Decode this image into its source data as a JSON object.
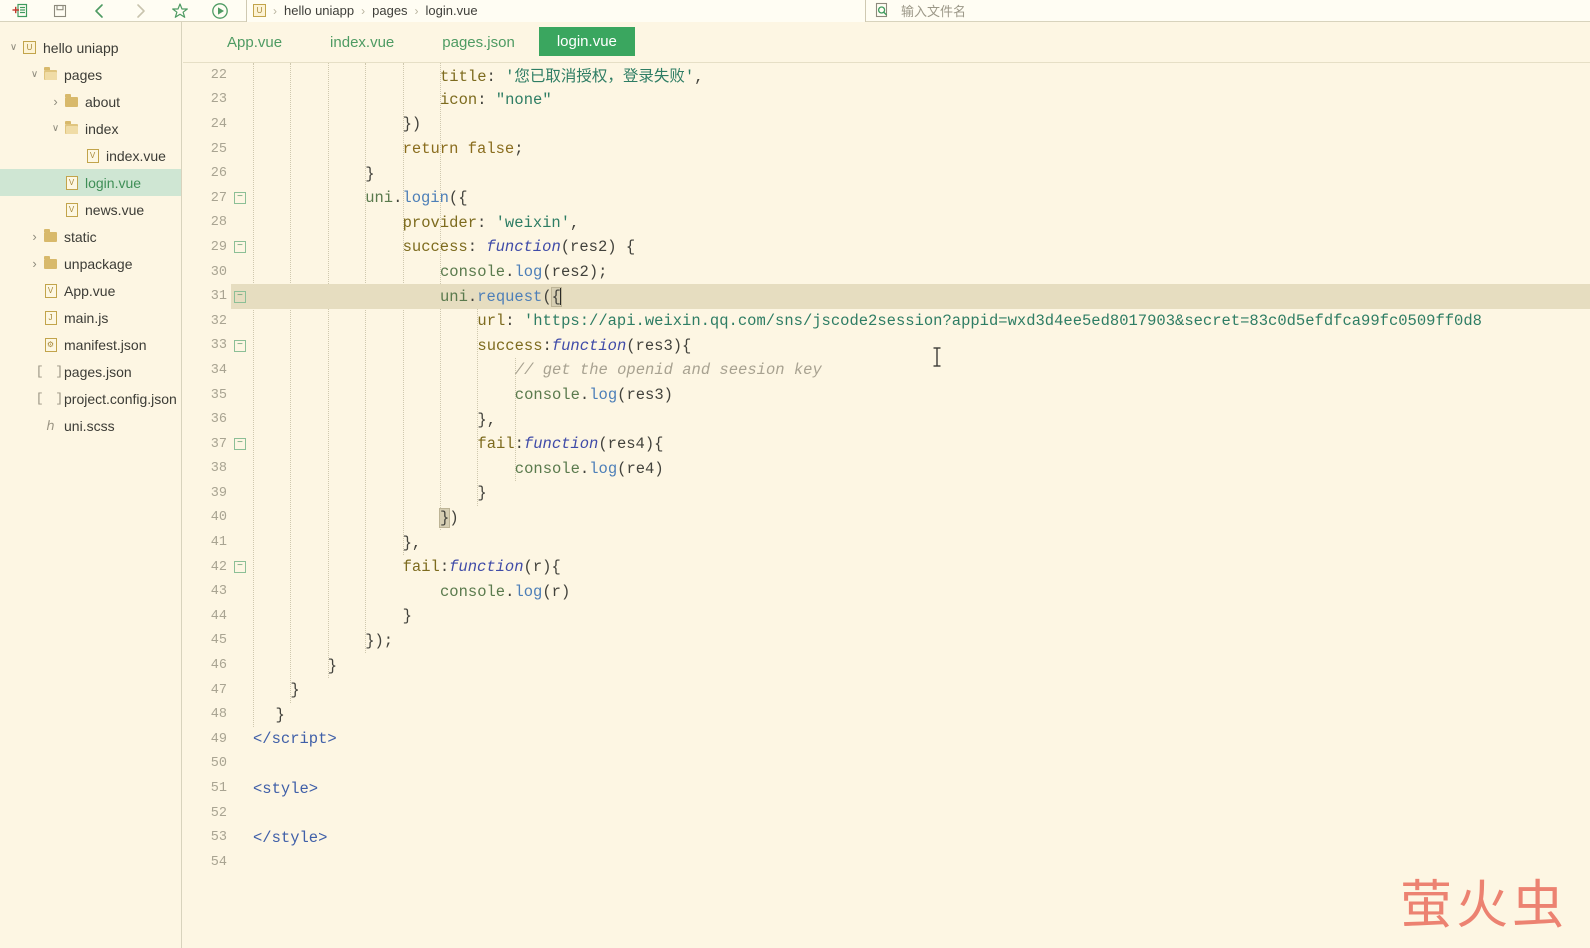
{
  "toolbar": {
    "buttons": [
      {
        "name": "new-file-icon",
        "label": "新建"
      },
      {
        "name": "save-icon",
        "label": "保存"
      },
      {
        "name": "back-arrow-icon",
        "label": "后退"
      },
      {
        "name": "forward-arrow-icon",
        "label": "前进"
      },
      {
        "name": "star-icon",
        "label": "收藏"
      },
      {
        "name": "run-icon",
        "label": "运行"
      }
    ]
  },
  "breadcrumb": {
    "project_icon": "U",
    "items": [
      "hello uniapp",
      "pages",
      "login.vue"
    ],
    "separator": "›"
  },
  "file_search": {
    "icon": "file-search-icon",
    "placeholder": "输入文件名",
    "value": ""
  },
  "sidebar": {
    "items": [
      {
        "label": "hello uniapp",
        "depth": 0,
        "type": "project",
        "expand": "down",
        "selected": false
      },
      {
        "label": "pages",
        "depth": 1,
        "type": "folder-open",
        "expand": "down",
        "selected": false
      },
      {
        "label": "about",
        "depth": 2,
        "type": "folder",
        "expand": "right",
        "selected": false
      },
      {
        "label": "index",
        "depth": 2,
        "type": "folder-open",
        "expand": "down",
        "selected": false
      },
      {
        "label": "index.vue",
        "depth": 3,
        "type": "vue",
        "expand": "none",
        "selected": false
      },
      {
        "label": "login.vue",
        "depth": 2,
        "type": "vue",
        "expand": "none",
        "selected": true
      },
      {
        "label": "news.vue",
        "depth": 2,
        "type": "vue",
        "expand": "none",
        "selected": false
      },
      {
        "label": "static",
        "depth": 1,
        "type": "folder",
        "expand": "right",
        "selected": false
      },
      {
        "label": "unpackage",
        "depth": 1,
        "type": "folder",
        "expand": "right",
        "selected": false
      },
      {
        "label": "App.vue",
        "depth": 1,
        "type": "vue",
        "expand": "none",
        "selected": false
      },
      {
        "label": "main.js",
        "depth": 1,
        "type": "js",
        "expand": "none",
        "selected": false
      },
      {
        "label": "manifest.json",
        "depth": 1,
        "type": "manifest",
        "expand": "none",
        "selected": false
      },
      {
        "label": "pages.json",
        "depth": 1,
        "type": "json",
        "expand": "none",
        "selected": false
      },
      {
        "label": "project.config.json",
        "depth": 1,
        "type": "json",
        "expand": "none",
        "selected": false
      },
      {
        "label": "uni.scss",
        "depth": 1,
        "type": "scss",
        "expand": "none",
        "selected": false
      }
    ]
  },
  "tabs": [
    {
      "label": "App.vue",
      "active": false
    },
    {
      "label": "index.vue",
      "active": false
    },
    {
      "label": "pages.json",
      "active": false
    },
    {
      "label": "login.vue",
      "active": true
    }
  ],
  "editor": {
    "active_line": 31,
    "first_visible_line": 22,
    "last_visible_line": 54,
    "lines": [
      {
        "n": 22,
        "fold": false,
        "indent": 5,
        "html": "<span class=\"t-prop\">title</span><span class=\"t-punct\">: </span><span class=\"t-str\">'您已取消授权，登录失败'</span><span class=\"t-punct\">,</span>"
      },
      {
        "n": 23,
        "fold": false,
        "indent": 5,
        "html": "<span class=\"t-prop\">icon</span><span class=\"t-punct\">: </span><span class=\"t-str\">\"none\"</span>"
      },
      {
        "n": 24,
        "fold": false,
        "indent": 4,
        "html": "<span class=\"t-punct\">})</span>"
      },
      {
        "n": 25,
        "fold": false,
        "indent": 4,
        "html": "<span class=\"t-kw\">return</span> <span class=\"t-kw\">false</span><span class=\"t-punct\">;</span>"
      },
      {
        "n": 26,
        "fold": false,
        "indent": 3,
        "html": "<span class=\"t-punct\">}</span>"
      },
      {
        "n": 27,
        "fold": true,
        "indent": 3,
        "html": "<span class=\"t-obj\">uni</span><span class=\"t-punct\">.</span><span class=\"t-method\">login</span><span class=\"t-punct\">({</span>"
      },
      {
        "n": 28,
        "fold": false,
        "indent": 4,
        "html": "<span class=\"t-prop\">provider</span><span class=\"t-punct\">: </span><span class=\"t-str\">'weixin'</span><span class=\"t-punct\">,</span>"
      },
      {
        "n": 29,
        "fold": true,
        "indent": 4,
        "html": "<span class=\"t-prop\">success</span><span class=\"t-punct\">: </span><span class=\"t-fnkw\">function</span><span class=\"t-punct\">(res2) {</span>"
      },
      {
        "n": 30,
        "fold": false,
        "indent": 5,
        "html": "<span class=\"t-obj\">console</span><span class=\"t-punct\">.</span><span class=\"t-method\">log</span><span class=\"t-punct\">(res2);</span>"
      },
      {
        "n": 31,
        "fold": true,
        "indent": 5,
        "html": "<span class=\"t-obj\">uni</span><span class=\"t-punct\">.</span><span class=\"t-method\">request</span><span class=\"t-punct\">(</span><span class=\"t-brkt\">{</span><span class=\"caret\"></span>"
      },
      {
        "n": 32,
        "fold": false,
        "indent": 6,
        "html": "<span class=\"t-prop\">url</span><span class=\"t-punct\">: </span><span class=\"t-str\">'https://api.weixin.qq.com/sns/jscode2session?appid=wxd3d4ee5ed8017903&amp;secret=83c0d5efdfca99fc0509ff0d8</span>"
      },
      {
        "n": 33,
        "fold": true,
        "indent": 6,
        "html": "<span class=\"t-prop\">success</span><span class=\"t-punct\">:</span><span class=\"t-fnkw\">function</span><span class=\"t-punct\">(res3){</span>"
      },
      {
        "n": 34,
        "fold": false,
        "indent": 7,
        "html": "<span class=\"t-comment\">// get the openid and seesion key</span>"
      },
      {
        "n": 35,
        "fold": false,
        "indent": 7,
        "html": "<span class=\"t-obj\">console</span><span class=\"t-punct\">.</span><span class=\"t-method\">log</span><span class=\"t-punct\">(res3)</span>"
      },
      {
        "n": 36,
        "fold": false,
        "indent": 6,
        "html": "<span class=\"t-punct\">},</span>"
      },
      {
        "n": 37,
        "fold": true,
        "indent": 6,
        "html": "<span class=\"t-prop\">fail</span><span class=\"t-punct\">:</span><span class=\"t-fnkw\">function</span><span class=\"t-punct\">(res4){</span>"
      },
      {
        "n": 38,
        "fold": false,
        "indent": 7,
        "html": "<span class=\"t-obj\">console</span><span class=\"t-punct\">.</span><span class=\"t-method\">log</span><span class=\"t-punct\">(re4)</span>"
      },
      {
        "n": 39,
        "fold": false,
        "indent": 6,
        "html": "<span class=\"t-punct\">}</span>"
      },
      {
        "n": 40,
        "fold": false,
        "indent": 5,
        "html": "<span class=\"t-brkt\">}</span><span class=\"t-punct\">)</span>"
      },
      {
        "n": 41,
        "fold": false,
        "indent": 4,
        "html": "<span class=\"t-punct\">},</span>"
      },
      {
        "n": 42,
        "fold": true,
        "indent": 4,
        "html": "<span class=\"t-prop\">fail</span><span class=\"t-punct\">:</span><span class=\"t-fnkw\">function</span><span class=\"t-punct\">(r){</span>"
      },
      {
        "n": 43,
        "fold": false,
        "indent": 5,
        "html": "<span class=\"t-obj\">console</span><span class=\"t-punct\">.</span><span class=\"t-method\">log</span><span class=\"t-punct\">(r)</span>"
      },
      {
        "n": 44,
        "fold": false,
        "indent": 4,
        "html": "<span class=\"t-punct\">}</span>"
      },
      {
        "n": 45,
        "fold": false,
        "indent": 3,
        "html": "<span class=\"t-punct\">});</span>"
      },
      {
        "n": 46,
        "fold": false,
        "indent": 2,
        "html": "<span class=\"t-punct\">}</span>"
      },
      {
        "n": 47,
        "fold": false,
        "indent": 1,
        "html": "<span class=\"t-punct\">}</span>"
      },
      {
        "n": 48,
        "fold": false,
        "indent": 0.6,
        "html": "<span class=\"t-punct\">}</span>"
      },
      {
        "n": 49,
        "fold": false,
        "indent": 0,
        "html": "<span class=\"t-tag\">&lt;/script&gt;</span>"
      },
      {
        "n": 50,
        "fold": false,
        "indent": 0,
        "html": ""
      },
      {
        "n": 51,
        "fold": false,
        "indent": 0,
        "html": "<span class=\"t-tag\">&lt;style&gt;</span>"
      },
      {
        "n": 52,
        "fold": false,
        "indent": 0,
        "html": ""
      },
      {
        "n": 53,
        "fold": false,
        "indent": 0,
        "html": "<span class=\"t-tag\">&lt;/style&gt;</span>"
      },
      {
        "n": 54,
        "fold": false,
        "indent": 0,
        "html": ""
      }
    ]
  },
  "watermark": {
    "text": "萤火虫",
    "color": "#ec8271"
  },
  "theme": {
    "background": "#fdf6e3",
    "accent_green": "#3aa65f",
    "selection_green": "#cfe6d3",
    "active_line": "#e6ddc0",
    "gutter_text": "#a9a492"
  }
}
